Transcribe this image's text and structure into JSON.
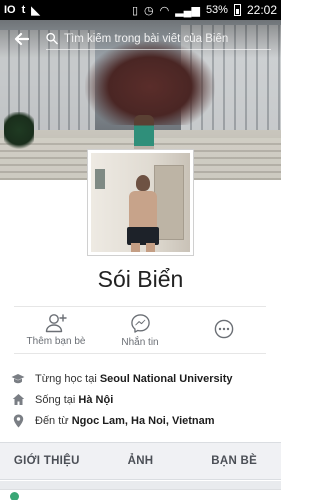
{
  "status_bar": {
    "left_icons": [
      "IO",
      "t",
      "◣"
    ],
    "battery": "53%",
    "time": "22:02"
  },
  "search": {
    "placeholder": "Tìm kiếm trong bài viết của Biển"
  },
  "profile": {
    "name": "Sói Biển"
  },
  "actions": [
    {
      "label": "Thêm bạn bè",
      "icon": "add-friend-icon"
    },
    {
      "label": "Nhắn tin",
      "icon": "messenger-icon"
    },
    {
      "label": "",
      "icon": "more-icon"
    }
  ],
  "info": {
    "education_prefix": "Từng học tại ",
    "education_value": "Seoul National University",
    "lives_prefix": "Sống tại ",
    "lives_value": "Hà Nội",
    "from_prefix": "Đến từ ",
    "from_value": "Ngoc Lam, Ha Noi, Vietnam"
  },
  "tabs": [
    "GIỚI THIỆU",
    "ẢNH",
    "BẠN BÈ"
  ],
  "colors": {
    "status_bar": "#000000",
    "tab_bar_bg": "#f0f1f4",
    "icon_gray": "#6b6f75"
  }
}
